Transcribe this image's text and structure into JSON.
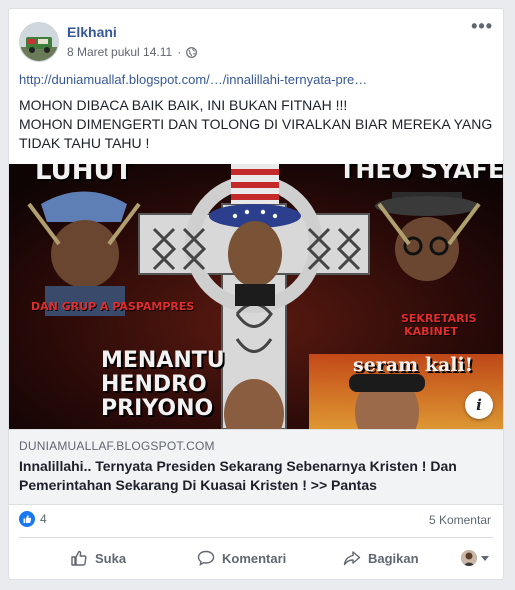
{
  "post": {
    "author": "Elkhani",
    "timestamp": "8 Maret pukul 14.11",
    "privacy_icon": "globe-icon",
    "more_icon": "ellipsis-icon",
    "link": "http://duniamuallaf.blogspot.com/…/innalillahi-ternyata-pre…",
    "text_line1": "MOHON DIBACA BAIK BAIK, INI BUKAN FITNAH !!!",
    "text_line2": "MOHON DIMENGERTI DAN TOLONG DI VIRALKAN BIAR MEREKA YANG TIDAK TAHU TAHU !"
  },
  "image": {
    "label_top_left": "LUHUT",
    "label_top_right": "THEO SYAFEI",
    "caption_left": "DAN GRUP A PASPAMPRES",
    "caption_right": "SEKRETARIS KABINET",
    "label_mid_line1": "MENANTU",
    "label_mid_line2": "HENDRO",
    "label_mid_line3": "PRIYONO",
    "label_seram": "seram kali!",
    "info_icon": "info-icon"
  },
  "preview": {
    "domain": "DUNIAMUALLAF.BLOGSPOT.COM",
    "title": "Innalillahi.. Ternyata Presiden Sekarang Sebenarnya Kristen ! Dan Pemerintahan Sekarang Di Kuasai Kristen ! >> Pantas"
  },
  "reactions": {
    "like_count": "4",
    "comments": "5 Komentar"
  },
  "actions": {
    "like": "Suka",
    "comment": "Komentari",
    "share": "Bagikan"
  },
  "colors": {
    "author": "#365899",
    "link": "#385898",
    "like_blue": "#1877f2",
    "background": "#e9ebee"
  }
}
